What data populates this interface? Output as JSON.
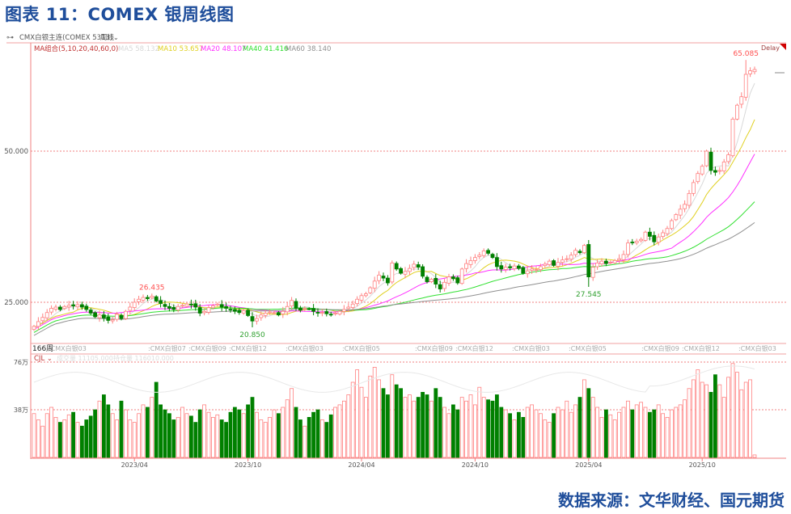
{
  "title": "图表 11：COMEX 银周线图",
  "source": "数据来源：文华财经、国元期货",
  "header": {
    "instrument": "CMX白银主连(COMEX 5313)",
    "period": "周线",
    "delay": "Delay"
  },
  "ma_legend": {
    "group": "MA组合(5,10,20,40,60,0)",
    "items": [
      {
        "label": "MA5 58.132",
        "color": "#d8d8d8"
      },
      {
        "label": "MA10 53.657",
        "color": "#e0d020"
      },
      {
        "label": "MA20 48.107",
        "color": "#ff30ff"
      },
      {
        "label": "MA40 41.416",
        "color": "#30e030"
      },
      {
        "label": "MA60 38.140",
        "color": "#909090"
      }
    ]
  },
  "volume_legend": {
    "name": "CJL",
    "volume": "成交量 11105.000",
    "open_interest": "持仓量 116010.000"
  },
  "bar_count": "166周",
  "contract_labels": [
    ":CMX白银03",
    ":CMX白银07",
    ":CMX白银09",
    ":CMX白银12",
    ":CMX白银03",
    ":CMX白银05",
    ":CMX白银09",
    ":CMX白银12",
    ":CMX白银03",
    ":CMX白银05",
    ":CMX白银09",
    ":CMX白银12",
    ":CMX白银03"
  ],
  "colors": {
    "up": "#ff8080",
    "down": "#008000",
    "grid": "#f08080",
    "text_blue": "#1f4e9b"
  },
  "chart_data": {
    "type": "candlestick",
    "period": "weekly",
    "price_axis": {
      "ticks": [
        "50.000",
        "25.000"
      ],
      "tick_values": [
        50,
        25
      ],
      "range": [
        16.5,
        67
      ]
    },
    "volume_axis": {
      "ticks": [
        "76万",
        "38万"
      ],
      "tick_values": [
        76,
        38
      ],
      "range": [
        0,
        80
      ]
    },
    "x_ticks": [
      "2023/04",
      "2023/10",
      "2024/04",
      "2024/10",
      "2025/04",
      "2025/10"
    ],
    "x_tick_index": [
      23,
      49,
      75,
      101,
      127,
      153
    ],
    "annotations": [
      {
        "label": "26.435",
        "value": 26.435,
        "index": 27,
        "kind": "high"
      },
      {
        "label": "20.850",
        "value": 20.85,
        "index": 50,
        "kind": "low"
      },
      {
        "label": "27.545",
        "value": 27.545,
        "index": 127,
        "kind": "low"
      },
      {
        "label": "65.085",
        "value": 65.085,
        "index": 163,
        "kind": "high"
      }
    ],
    "closes": [
      21.0,
      21.8,
      22.5,
      23.3,
      24.0,
      24.2,
      23.8,
      24.3,
      24.5,
      24.4,
      24.6,
      24.2,
      23.8,
      23.2,
      22.6,
      22.9,
      22.4,
      22.0,
      22.1,
      23.0,
      22.3,
      23.5,
      24.2,
      25.0,
      25.5,
      25.8,
      25.6,
      26.0,
      25.2,
      24.8,
      24.3,
      24.0,
      23.8,
      24.3,
      24.5,
      24.7,
      24.6,
      24.2,
      23.2,
      23.5,
      24.1,
      24.4,
      24.7,
      24.2,
      24.0,
      23.8,
      23.5,
      23.3,
      23.6,
      22.8,
      21.9,
      22.3,
      22.9,
      23.2,
      23.4,
      23.3,
      22.9,
      23.5,
      24.3,
      25.3,
      24.0,
      23.7,
      24.0,
      23.9,
      23.5,
      23.2,
      23.3,
      23.1,
      23.0,
      23.2,
      23.5,
      23.8,
      24.2,
      24.7,
      25.5,
      26.1,
      26.4,
      27.4,
      28.5,
      29.5,
      29.0,
      28.2,
      31.5,
      30.5,
      29.8,
      30.1,
      30.6,
      31.3,
      30.8,
      29.3,
      28.4,
      28.8,
      28.0,
      27.2,
      28.3,
      29.2,
      28.9,
      28.2,
      30.5,
      31.4,
      31.9,
      32.4,
      32.8,
      33.5,
      33.1,
      32.4,
      30.9,
      30.5,
      30.8,
      30.7,
      31.0,
      30.6,
      29.8,
      30.2,
      30.5,
      30.4,
      30.9,
      31.3,
      31.8,
      31.1,
      31.6,
      32.0,
      32.2,
      32.8,
      33.6,
      33.2,
      34.4,
      29.2,
      30.8,
      31.5,
      31.8,
      31.4,
      31.6,
      31.9,
      32.2,
      32.9,
      34.8,
      34.9,
      35.1,
      35.4,
      36.6,
      35.9,
      35.0,
      35.8,
      36.5,
      37.2,
      38.5,
      39.5,
      40.4,
      41.2,
      43.0,
      44.8,
      46.3,
      47.5,
      50.0,
      46.8,
      46.5,
      46.8,
      48.2,
      49.4,
      55.3,
      57.6,
      59.0,
      62.7,
      63.3,
      63.5
    ],
    "volumes_wan": [
      35,
      30,
      25,
      35,
      40,
      32,
      28,
      30,
      34,
      36,
      28,
      25,
      30,
      33,
      38,
      45,
      50,
      42,
      35,
      30,
      45,
      38,
      30,
      28,
      35,
      42,
      40,
      48,
      60,
      42,
      38,
      35,
      30,
      32,
      40,
      35,
      33,
      28,
      38,
      42,
      36,
      32,
      34,
      30,
      28,
      36,
      40,
      38,
      35,
      42,
      48,
      36,
      30,
      28,
      32,
      38,
      35,
      40,
      46,
      55,
      40,
      30,
      25,
      32,
      36,
      38,
      30,
      28,
      34,
      40,
      42,
      45,
      50,
      60,
      70,
      56,
      48,
      65,
      72,
      62,
      55,
      50,
      66,
      58,
      55,
      48,
      50,
      45,
      48,
      52,
      50,
      45,
      55,
      48,
      40,
      35,
      42,
      38,
      48,
      45,
      50,
      42,
      56,
      48,
      46,
      45,
      50,
      40,
      38,
      35,
      30,
      36,
      32,
      40,
      42,
      38,
      35,
      30,
      28,
      35,
      40,
      38,
      45,
      36,
      42,
      48,
      62,
      55,
      48,
      40,
      32,
      38,
      34,
      30,
      36,
      40,
      45,
      38,
      42,
      44,
      40,
      36,
      38,
      42,
      35,
      32,
      38,
      40,
      42,
      46,
      55,
      62,
      70,
      60,
      58,
      52,
      66,
      58,
      48,
      64,
      75,
      68,
      54,
      60,
      62,
      2
    ],
    "ma_periods": [
      5,
      10,
      20,
      40,
      60
    ]
  }
}
